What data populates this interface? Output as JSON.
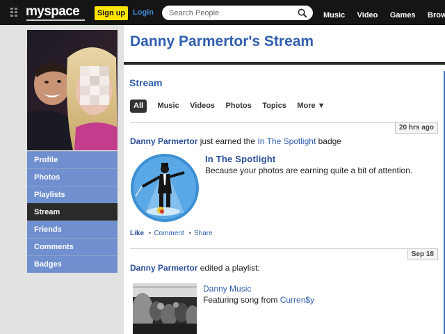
{
  "nav": {
    "logo": "myspace",
    "signup_label": "Sign up",
    "login_label": "Login",
    "search_placeholder": "Search People",
    "links": [
      "Music",
      "Video",
      "Games",
      "Browse P"
    ]
  },
  "sidebar": {
    "items": [
      {
        "label": "Profile"
      },
      {
        "label": "Photos"
      },
      {
        "label": "Playlists"
      },
      {
        "label": "Stream"
      },
      {
        "label": "Friends"
      },
      {
        "label": "Comments"
      },
      {
        "label": "Badges"
      }
    ],
    "active_index": 3
  },
  "main": {
    "title": "Danny Parmertor's Stream",
    "stream_heading": "Stream",
    "filters": [
      "All",
      "Music",
      "Videos",
      "Photos",
      "Topics",
      "More ▼"
    ],
    "active_filter": 0
  },
  "feed": [
    {
      "timestamp": "20 hrs ago",
      "user": "Danny Parmertor",
      "text_before": " just earned the ",
      "badge_link": "In The Spotlight",
      "text_after": " badge",
      "badge_title": "In The Spotlight",
      "badge_desc": "Because your photos are earning quite a bit of attention.",
      "actions": {
        "like": "Like",
        "comment": "Comment",
        "share": "Share",
        "separator": "•"
      }
    },
    {
      "timestamp": "Sep 18",
      "user": "Danny Parmertor",
      "text": " edited a playlist:",
      "playlist_title": "Danny Music",
      "playlist_desc_prefix": "Featuring song from ",
      "playlist_artist": "Curren$y"
    }
  ],
  "colors": {
    "nav_bg": "#151515",
    "signup_bg": "#fde500",
    "login": "#3b8bd6",
    "sidebar_item": "#6f8fcf",
    "sidebar_active": "#2a2a2a",
    "heading_blue": "#2f5fae",
    "page_bg": "#e2e2e2"
  }
}
